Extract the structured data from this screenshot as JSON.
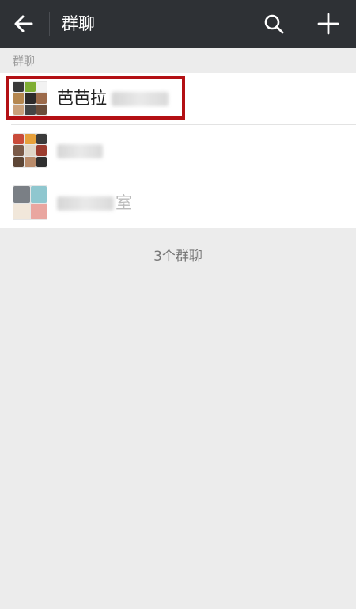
{
  "header": {
    "title": "群聊"
  },
  "section": {
    "label": "群聊"
  },
  "groups": [
    {
      "name": "芭芭拉",
      "name_suffix_obscured": "微信群"
    },
    {
      "name": "",
      "name_suffix_obscured": ""
    },
    {
      "name": "",
      "name_suffix_obscured": "室"
    }
  ],
  "footer": {
    "count_text": "3个群聊"
  },
  "colors": {
    "topbar": "#2e3135",
    "highlight": "#b31014",
    "background": "#ececec"
  },
  "icons": {
    "back": "arrow-left-icon",
    "search": "search-icon",
    "add": "plus-icon"
  }
}
